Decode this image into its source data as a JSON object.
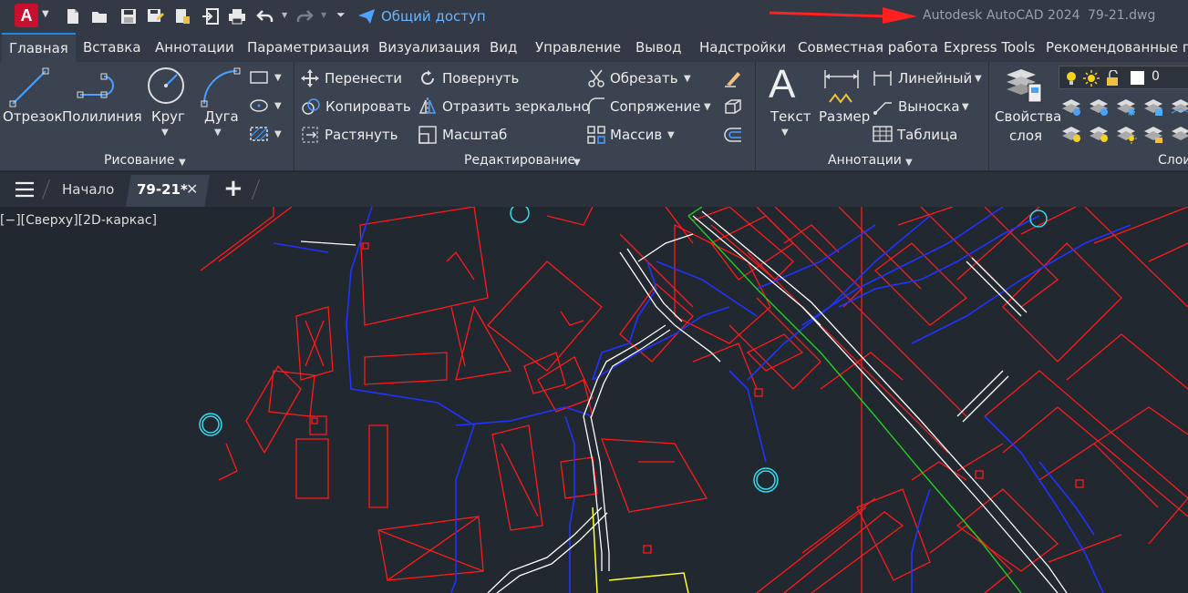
{
  "titlebar": {
    "app_letter": "A",
    "share_label": "Общий доступ",
    "app_name": "Autodesk AutoCAD 2024",
    "file_name": "79-21.dwg"
  },
  "ribbon_tabs": [
    "Главная",
    "Вставка",
    "Аннотации",
    "Параметризация",
    "Визуализация",
    "Вид",
    "Управление",
    "Вывод",
    "Надстройки",
    "Совместная работа",
    "Express Tools",
    "Рекомендованные при"
  ],
  "draw_panel": {
    "line": "Отрезок",
    "polyline": "Полилиния",
    "circle": "Круг",
    "arc": "Дуга",
    "title": "Рисование"
  },
  "modify_panel": {
    "move": "Перенести",
    "copy": "Копировать",
    "stretch": "Растянуть",
    "rotate": "Повернуть",
    "mirror": "Отразить зеркально",
    "scale": "Масштаб",
    "trim": "Обрезать",
    "fillet": "Сопряжение",
    "array": "Массив",
    "title": "Редактирование"
  },
  "annotation_panel": {
    "text": "Текст",
    "dimension": "Размер",
    "linear": "Линейный",
    "leader": "Выноска",
    "table": "Таблица",
    "title": "Аннотации"
  },
  "layers_panel": {
    "properties_line1": "Свойства",
    "properties_line2": "слоя",
    "current_layer": "0",
    "title": "Слои"
  },
  "doc_tabs": {
    "start": "Начало",
    "active": "79-21*"
  },
  "viewport": {
    "view_label": "[−][Сверху][2D-каркас]"
  },
  "colors": {
    "accent": "#1e88e5",
    "cad_red": "#ff1a1a",
    "cad_blue": "#1a1aff",
    "cad_green": "#22cc22",
    "cad_white": "#ffffff",
    "cad_yellow": "#ffff33",
    "cad_cyan": "#33ddee"
  }
}
